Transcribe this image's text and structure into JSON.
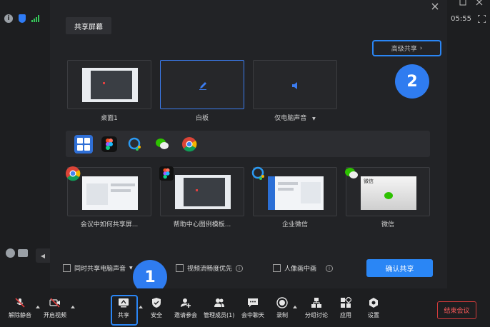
{
  "top_bar": {
    "time": "05:55"
  },
  "dialog": {
    "tab_label": "共享屏幕",
    "advanced_share_label": "高级共享",
    "tiles_row1": [
      {
        "label": "桌面1"
      },
      {
        "label": "白板"
      },
      {
        "label": "仅电脑声音"
      }
    ],
    "tiles_row2": [
      {
        "label": "会议中如何共享屏..."
      },
      {
        "label": "帮助中心图例模板..."
      },
      {
        "label": "企业微信"
      },
      {
        "label": "微信"
      }
    ],
    "wechat_window_title": "微信",
    "options": {
      "share_audio": "同时共享电脑声音",
      "smooth_video": "视频流畅度优先",
      "portrait_in_picture": "人像画中画"
    },
    "confirm_label": "确认共享"
  },
  "steps": {
    "one": "1",
    "two": "2"
  },
  "toolbar": {
    "unmute": "解除静音",
    "start_video": "开启视频",
    "share": "共享",
    "security": "安全",
    "invite": "邀请参会",
    "manage_members": "管理成员(1)",
    "chat": "会中聊天",
    "record": "录制",
    "breakout": "分组讨论",
    "apps": "应用",
    "settings": "设置",
    "end_meeting": "结束会议"
  },
  "colors": {
    "accent": "#2a86f5",
    "danger": "#d23b3b",
    "dialog_bg": "#222326"
  }
}
